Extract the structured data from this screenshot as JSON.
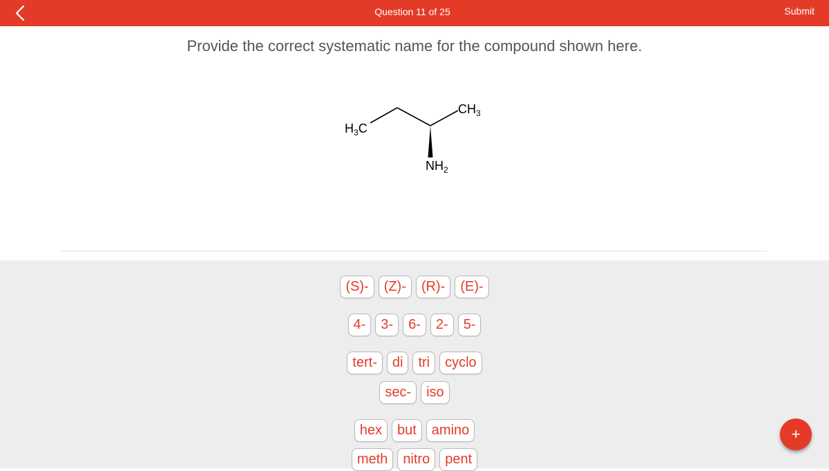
{
  "header": {
    "back_icon": "chevron-left-icon",
    "question_counter": "Question 11 of 25",
    "submit_label": "Submit",
    "accent_color": "#e33b28"
  },
  "question": {
    "prompt": "Provide the correct systematic name for the compound shown here."
  },
  "molecule": {
    "labels": {
      "left": "H3C",
      "right": "CH3",
      "bottom": "NH2"
    },
    "stereo_bond": "wedge"
  },
  "tray": {
    "rows": [
      [
        "(S)-",
        "(Z)-",
        "(R)-",
        "(E)-"
      ],
      [
        "4-",
        "3-",
        "6-",
        "2-",
        "5-"
      ],
      [
        "tert-",
        "di",
        "tri",
        "cyclo"
      ],
      [
        "sec-",
        "iso"
      ],
      [
        "hex",
        "but",
        "amino"
      ],
      [
        "meth",
        "nitro",
        "pent"
      ]
    ]
  },
  "fab": {
    "label": "+",
    "icon": "plus-icon"
  }
}
